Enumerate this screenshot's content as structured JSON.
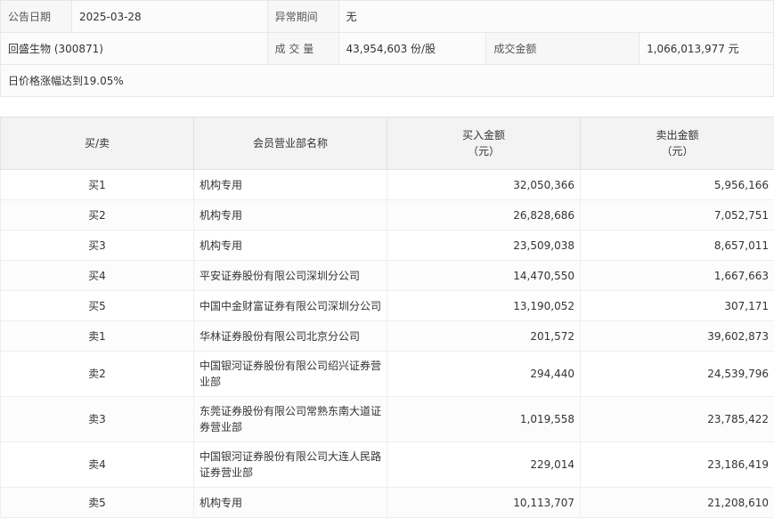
{
  "summary": {
    "date_label": "公告日期",
    "date_value": "2025-03-28",
    "abnormal_label": "异常期间",
    "abnormal_value": "无",
    "stock_name": "回盛生物 (300871)",
    "volume_label": "成 交 量",
    "volume_value": "43,954,603 份/股",
    "amount_label": "成交金额",
    "amount_value": "1,066,013,977 元",
    "reason": "日价格涨幅达到19.05%"
  },
  "table": {
    "headers": {
      "side": "买/卖",
      "dept": "会员营业部名称",
      "buy_line1": "买入金额",
      "buy_line2": "（元）",
      "sell_line1": "卖出金额",
      "sell_line2": "（元）"
    },
    "rows": [
      {
        "side": "买1",
        "dept": "机构专用",
        "buy": "32,050,366",
        "sell": "5,956,166"
      },
      {
        "side": "买2",
        "dept": "机构专用",
        "buy": "26,828,686",
        "sell": "7,052,751"
      },
      {
        "side": "买3",
        "dept": "机构专用",
        "buy": "23,509,038",
        "sell": "8,657,011"
      },
      {
        "side": "买4",
        "dept": "平安证券股份有限公司深圳分公司",
        "buy": "14,470,550",
        "sell": "1,667,663"
      },
      {
        "side": "买5",
        "dept": "中国中金财富证券有限公司深圳分公司",
        "buy": "13,190,052",
        "sell": "307,171"
      },
      {
        "side": "卖1",
        "dept": "华林证券股份有限公司北京分公司",
        "buy": "201,572",
        "sell": "39,602,873"
      },
      {
        "side": "卖2",
        "dept": "中国银河证券股份有限公司绍兴证券营业部",
        "buy": "294,440",
        "sell": "24,539,796"
      },
      {
        "side": "卖3",
        "dept": "东莞证券股份有限公司常熟东南大道证券营业部",
        "buy": "1,019,558",
        "sell": "23,785,422"
      },
      {
        "side": "卖4",
        "dept": "中国银河证券股份有限公司大连人民路证券营业部",
        "buy": "229,014",
        "sell": "23,186,419"
      },
      {
        "side": "卖5",
        "dept": "机构专用",
        "buy": "10,113,707",
        "sell": "21,208,610"
      }
    ]
  }
}
